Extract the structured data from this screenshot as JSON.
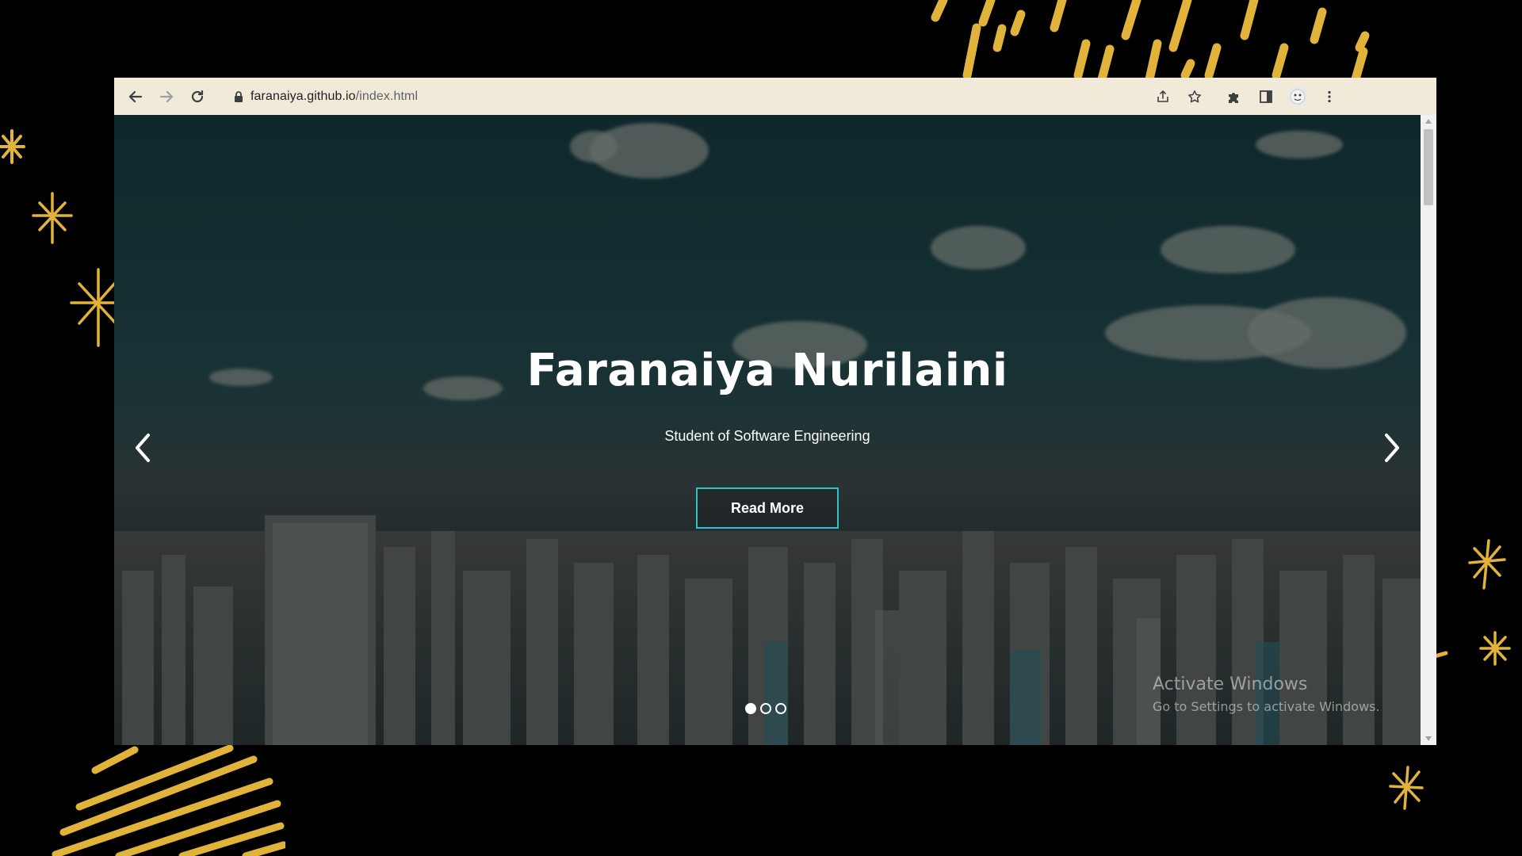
{
  "browser": {
    "url_host": "faranaiya.github.io",
    "url_path": "/index.html"
  },
  "hero": {
    "title": "Faranaiya Nurilaini",
    "subtitle": "Student of Software Engineering",
    "button_label": "Read More",
    "slides_total": 3,
    "active_slide_index": 0
  },
  "watermark": {
    "line1": "Activate Windows",
    "line2": "Go to Settings to activate Windows."
  },
  "colors": {
    "accent": "#2cc3c8",
    "toolbar_bg": "#f1ead8",
    "gold": "#e2b33b"
  },
  "icons": {
    "back": "arrow-left-icon",
    "forward": "arrow-right-icon",
    "reload": "reload-icon",
    "lock": "lock-icon",
    "share": "share-icon",
    "bookmark": "star-icon",
    "extensions": "puzzle-icon",
    "side_panel": "side-panel-icon",
    "profile": "avatar",
    "menu": "kebab-menu-icon",
    "carousel_prev": "chevron-left-icon",
    "carousel_next": "chevron-right-icon"
  }
}
